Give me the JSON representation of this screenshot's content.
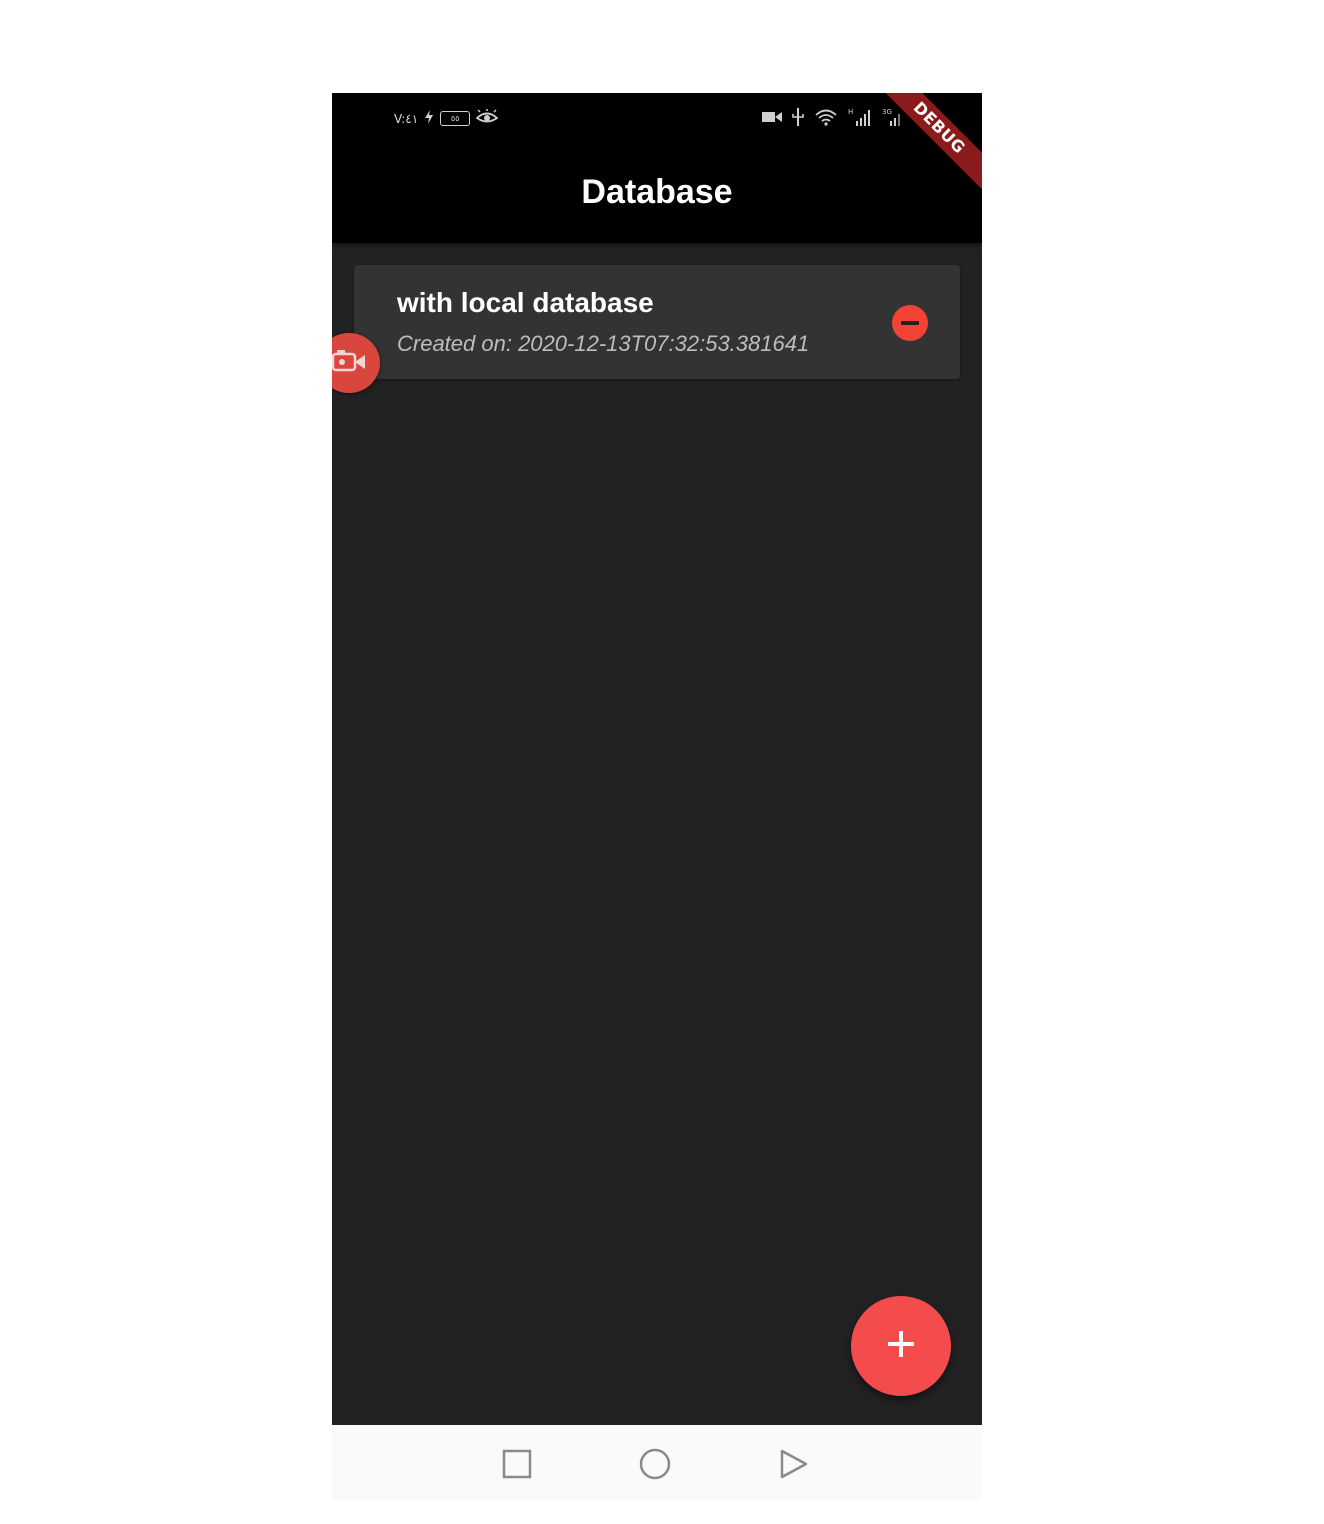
{
  "status_bar": {
    "time": "V:٤١",
    "battery_level": "٥٥"
  },
  "app_bar": {
    "title": "Database",
    "debug_banner": "DEBUG"
  },
  "list": {
    "items": [
      {
        "title": "with local database",
        "subtitle": "Created on: 2020-12-13T07:32:53.381641"
      }
    ]
  },
  "icons": {
    "status_left": [
      "clock-text",
      "bolt-icon",
      "battery-icon",
      "eye-icon"
    ],
    "status_right": [
      "video-icon",
      "usb-icon",
      "wifi-icon",
      "signal-h-icon",
      "signal-3g-icon"
    ],
    "card_action": "remove-circle-icon",
    "overlay": "screen-recorder-icon",
    "fab": "add-icon",
    "nav": [
      "recents-square-icon",
      "home-circle-icon",
      "back-triangle-icon"
    ]
  },
  "colors": {
    "background": "#222222",
    "app_bar": "#000000",
    "card": "#333333",
    "accent": "#f44c4c",
    "debug_banner": "#8b1a1a",
    "nav_bar": "#fafafa"
  }
}
